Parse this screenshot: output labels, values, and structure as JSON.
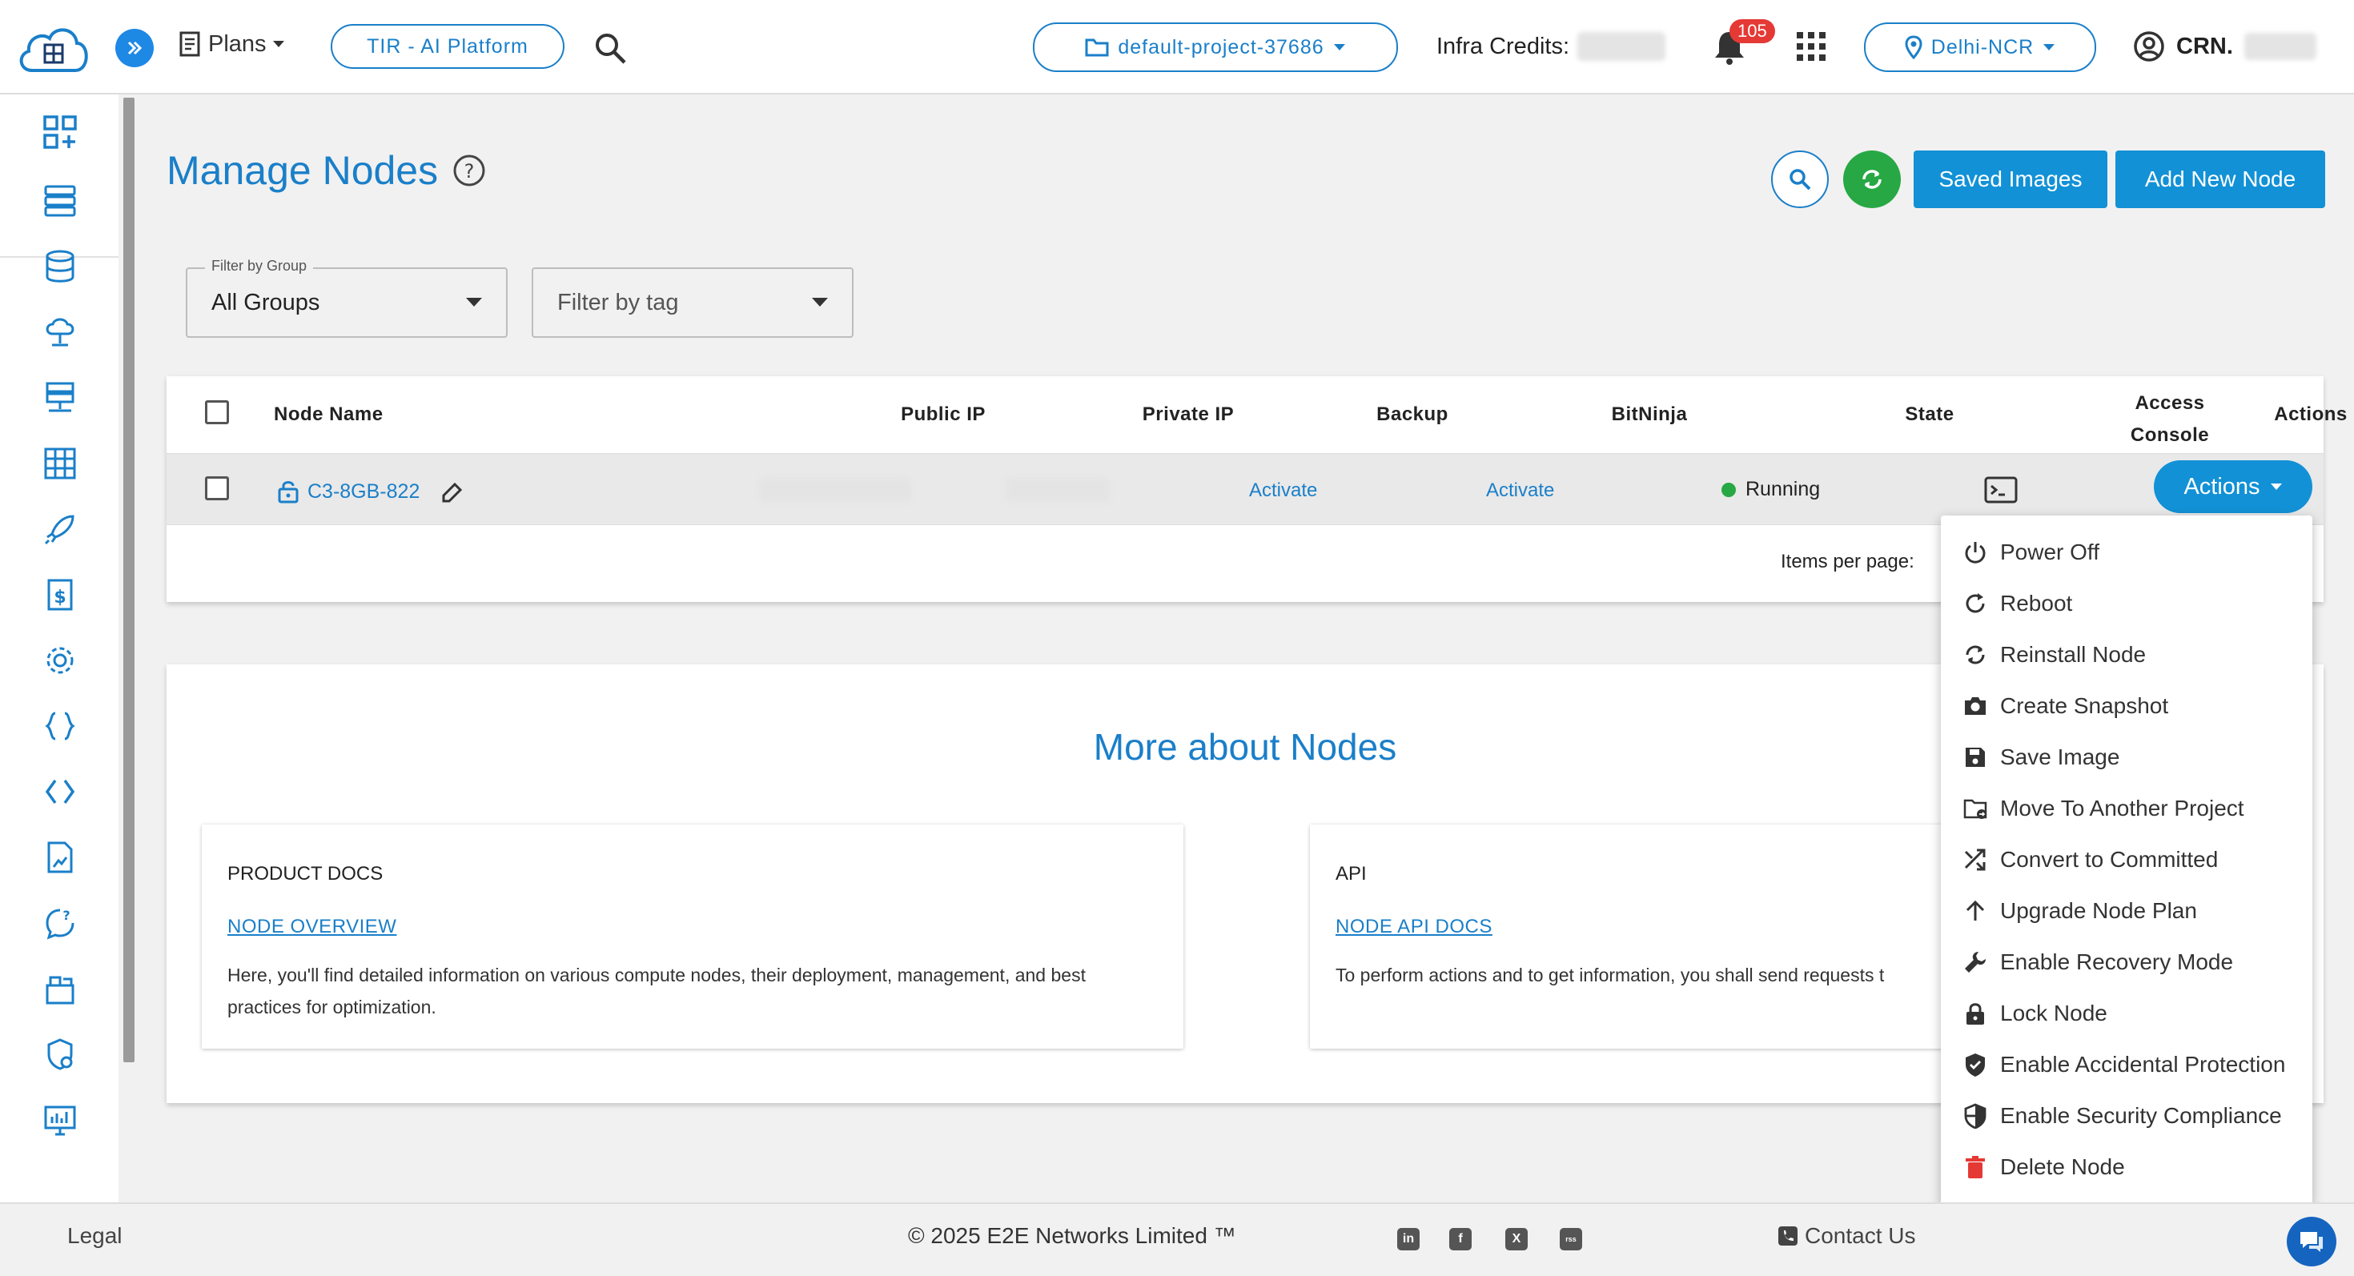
{
  "topbar": {
    "plans_label": "Plans",
    "platform_label": "TIR - AI Platform",
    "project_label": "default-project-37686",
    "infra_credits_label": "Infra Credits:",
    "notification_count": "105",
    "region_label": "Delhi-NCR",
    "user_label": "CRN."
  },
  "page": {
    "title": "Manage Nodes",
    "saved_images_label": "Saved Images",
    "add_node_label": "Add New Node"
  },
  "filters": {
    "group_legend": "Filter by Group",
    "group_value": "All Groups",
    "tag_placeholder": "Filter by tag"
  },
  "table": {
    "columns": [
      "Node Name",
      "Public IP",
      "Private IP",
      "Backup",
      "BitNinja",
      "State",
      "Access",
      "Console",
      "Actions"
    ],
    "rows": [
      {
        "node_name": "C3-8GB-822",
        "backup": "Activate",
        "bitninja": "Activate",
        "state": "Running",
        "actions_label": "Actions"
      }
    ],
    "items_per_page_label": "Items per page:"
  },
  "more_about": {
    "title": "More about Nodes",
    "product_docs": {
      "heading": "PRODUCT DOCS",
      "link": "NODE OVERVIEW",
      "text": "Here, you'll find detailed information on various compute nodes, their deployment, management, and best practices for optimization."
    },
    "api": {
      "heading": "API",
      "link": "NODE API DOCS",
      "text": "To perform actions and to get information, you shall send requests t"
    }
  },
  "actions_menu": [
    {
      "label": "Power Off",
      "icon": "power-icon"
    },
    {
      "label": "Reboot",
      "icon": "reboot-icon"
    },
    {
      "label": "Reinstall Node",
      "icon": "reinstall-icon"
    },
    {
      "label": "Create Snapshot",
      "icon": "camera-icon"
    },
    {
      "label": "Save Image",
      "icon": "save-icon"
    },
    {
      "label": "Move To Another Project",
      "icon": "folder-move-icon"
    },
    {
      "label": "Convert to Committed",
      "icon": "shuffle-icon"
    },
    {
      "label": "Upgrade Node Plan",
      "icon": "arrow-up-icon"
    },
    {
      "label": "Enable Recovery Mode",
      "icon": "wrench-icon"
    },
    {
      "label": "Lock Node",
      "icon": "lock-icon"
    },
    {
      "label": "Enable Accidental Protection",
      "icon": "shield-check-icon"
    },
    {
      "label": "Enable Security Compliance",
      "icon": "shield-half-icon"
    },
    {
      "label": "Delete Node",
      "icon": "trash-icon"
    }
  ],
  "footer": {
    "legal": "Legal",
    "copyright": "© 2025 E2E Networks Limited ™",
    "contact": "Contact Us",
    "social": [
      "in",
      "f",
      "X",
      "rss"
    ]
  },
  "colors": {
    "accent": "#1a7fc9",
    "primary_button": "#1291d6",
    "success": "#27a844",
    "danger": "#e53935"
  }
}
